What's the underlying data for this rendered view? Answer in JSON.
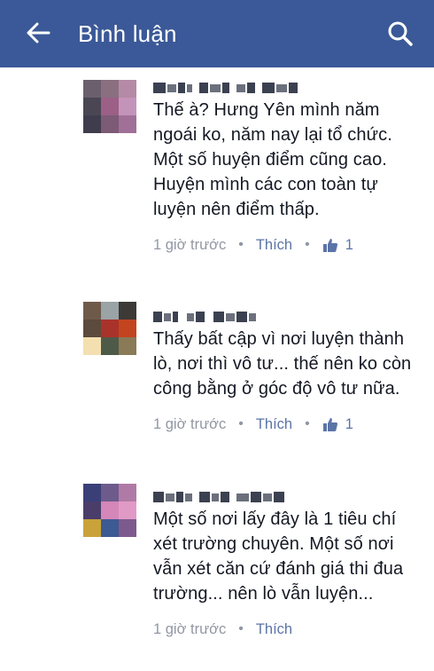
{
  "appbar": {
    "title": "Bình luận",
    "back_icon": "arrow-left-icon",
    "search_icon": "search-icon",
    "color": "#3b5998"
  },
  "comments": [
    {
      "text": "Thế à? Hưng Yên mình năm ngoái ko, năm nay lại tổ chức. Một số huyện điểm cũng cao. Huyện mình  các con toàn tự luyện nên điểm thấp.",
      "time": "1 giờ trước",
      "like_label": "Thích",
      "like_count": "1",
      "avatar_colors": [
        "#6b5f6e",
        "#8a6f80",
        "#b58aa6",
        "#4a4654",
        "#9c5f86",
        "#c493ba",
        "#3f3d4d",
        "#7d5a76",
        "#a07098"
      ]
    },
    {
      "text": "Thấy bất cập vì nơi luyện thành lò, nơi thì vô tư... thế nên ko còn công bằng ở góc độ vô tư nữa.",
      "time": "1 giờ trước",
      "like_label": "Thích",
      "like_count": "1",
      "avatar_colors": [
        "#6f5a4a",
        "#9aa3a6",
        "#3c3a36",
        "#5c4a3d",
        "#a9332b",
        "#c2451f",
        "#f4dfb0",
        "#4e5a48",
        "#8a7a57"
      ]
    },
    {
      "text": "Một số nơi lấy đây là 1 tiêu chí xét trường chuyên. Một số nơi vẫn xét căn cứ đánh giá thi đua trường... nên lò vẫn luyện...",
      "time": "1 giờ trước",
      "like_label": "Thích",
      "avatar_colors": [
        "#3a3f78",
        "#6d5b8c",
        "#b07aa6",
        "#4a3d6a",
        "#d487b8",
        "#e19ac6",
        "#c9a23a",
        "#3e5a92",
        "#7d5a8e"
      ]
    }
  ]
}
